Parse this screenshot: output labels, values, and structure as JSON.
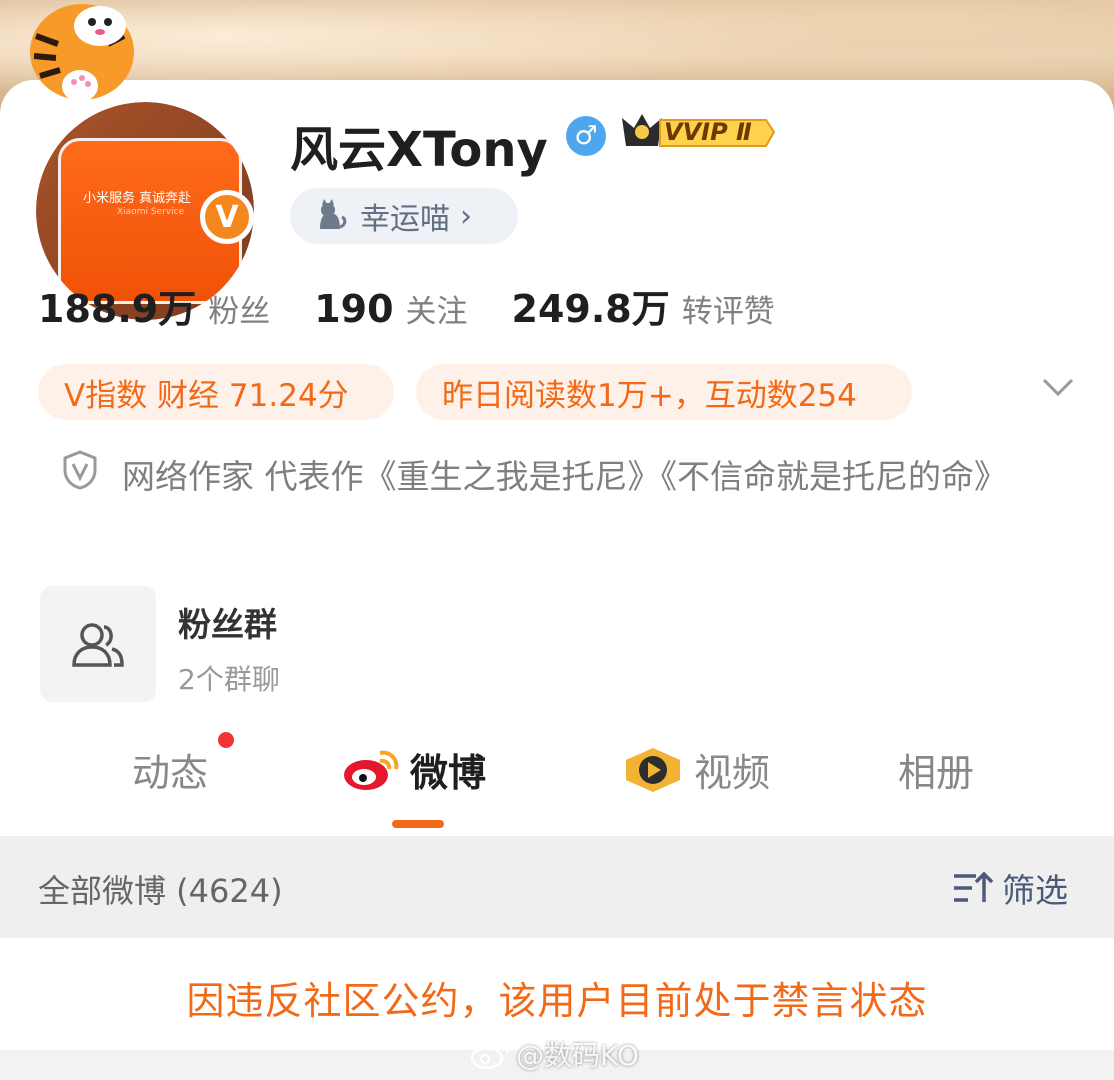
{
  "profile": {
    "username": "风云XTony",
    "verified_badge": "V",
    "vip_label": "VVIP Ⅱ",
    "lucky_label": "幸运喵",
    "lucky_chevron": "›"
  },
  "stats": [
    {
      "value": "188.9万",
      "label": "粉丝"
    },
    {
      "value": "190",
      "label": "关注"
    },
    {
      "value": "249.8万",
      "label": "转评赞"
    }
  ],
  "pills": {
    "v_index": "V指数 财经 71.24分",
    "reads": "昨日阅读数1万+，互动数254"
  },
  "bio": "网络作家 代表作《重生之我是托尼》《不信命就是托尼的命》",
  "fan_group": {
    "title": "粉丝群",
    "subtitle": "2个群聊"
  },
  "tabs": [
    {
      "label": "动态",
      "active": false
    },
    {
      "label": "微博",
      "active": true
    },
    {
      "label": "视频",
      "active": false
    },
    {
      "label": "相册",
      "active": false
    }
  ],
  "feed": {
    "all_weibo": "全部微博 (4624)",
    "filter_label": "筛选",
    "notice": "因违反社区公约，该用户目前处于禁言状态"
  },
  "watermark": "@数码KO",
  "avatar": {
    "box_text": "小米服务 真诚奔赴",
    "box_sub": "Xiaomi Service"
  },
  "colors": {
    "accent": "#f26a18",
    "pill_bg": "#fef1e9",
    "male_blue": "#4ea6ef",
    "verified_orange": "#f5871f"
  },
  "icons": [
    "male-icon",
    "vvip-crown-icon",
    "cat-icon",
    "chevron-down-icon",
    "shield-v-icon",
    "group-people-icon",
    "weibo-logo-icon",
    "video-play-icon",
    "filter-icon",
    "weibo-watermark-icon"
  ]
}
